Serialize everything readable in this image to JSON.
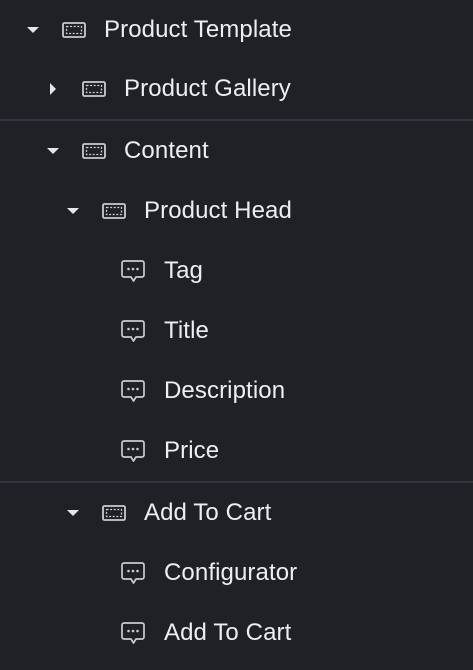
{
  "tree": {
    "product_template": {
      "label": "Product Template",
      "expanded": true,
      "icon": "container-icon"
    },
    "product_gallery": {
      "label": "Product Gallery",
      "expanded": false,
      "icon": "container-icon"
    },
    "content": {
      "label": "Content",
      "expanded": true,
      "icon": "container-icon"
    },
    "product_head": {
      "label": "Product Head",
      "expanded": true,
      "icon": "container-icon"
    },
    "tag": {
      "label": "Tag",
      "icon": "text-widget-icon"
    },
    "title": {
      "label": "Title",
      "icon": "text-widget-icon"
    },
    "description": {
      "label": "Description",
      "icon": "text-widget-icon"
    },
    "price": {
      "label": "Price",
      "icon": "text-widget-icon"
    },
    "add_to_cart_container": {
      "label": "Add To Cart",
      "expanded": true,
      "icon": "container-icon"
    },
    "configurator": {
      "label": "Configurator",
      "icon": "text-widget-icon"
    },
    "add_to_cart_widget": {
      "label": "Add To Cart",
      "icon": "text-widget-icon"
    }
  },
  "colors": {
    "background": "#202126",
    "text": "#eceef2",
    "icon": "#c9cbd1",
    "divider": "#34363d"
  }
}
